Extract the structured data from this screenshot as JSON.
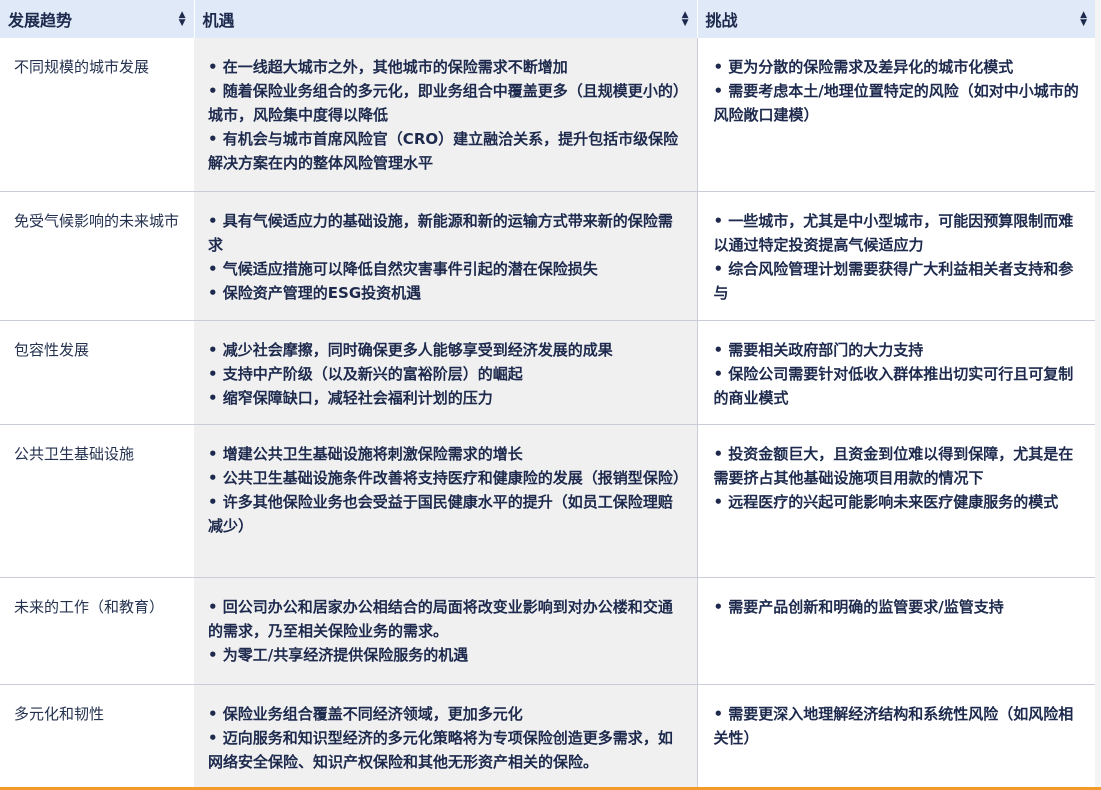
{
  "header": {
    "col1": "发展趋势",
    "col2": "机遇",
    "col3": "挑战",
    "sort_glyph_up": "▲",
    "sort_glyph_down": "▼"
  },
  "rows": [
    {
      "trend": "不同规模的城市发展",
      "opportunities": [
        "• 在一线超大城市之外，其他城市的保险需求不断增加",
        "• 随着保险业务组合的多元化，即业务组合中覆盖更多（且规模更小的）城市，风险集中度得以降低",
        "• 有机会与城市首席风险官（CRO）建立融洽关系，提升包括市级保险解决方案在内的整体风险管理水平"
      ],
      "challenges": [
        "• 更为分散的保险需求及差异化的城市化模式",
        "• 需要考虑本土/地理位置特定的风险（如对中小城市的风险敞口建模）"
      ]
    },
    {
      "trend": "免受气候影响的未来城市",
      "opportunities": [
        "• 具有气候适应力的基础设施，新能源和新的运输方式带来新的保险需求",
        "• 气候适应措施可以降低自然灾害事件引起的潜在保险损失",
        "• 保险资产管理的ESG投资机遇"
      ],
      "challenges": [
        "• 一些城市，尤其是中小型城市，可能因预算限制而难以通过特定投资提高气候适应力",
        "• 综合风险管理计划需要获得广大利益相关者支持和参与"
      ]
    },
    {
      "trend": "包容性发展",
      "opportunities": [
        "• 减少社会摩擦，同时确保更多人能够享受到经济发展的成果",
        "• 支持中产阶级（以及新兴的富裕阶层）的崛起",
        "• 缩窄保障缺口，减轻社会福利计划的压力"
      ],
      "challenges": [
        "• 需要相关政府部门的大力支持",
        "• 保险公司需要针对低收入群体推出切实可行且可复制的商业模式"
      ]
    },
    {
      "trend": "公共卫生基础设施",
      "opportunities": [
        "• 增建公共卫生基础设施将刺激保险需求的增长",
        "• 公共卫生基础设施条件改善将支持医疗和健康险的发展（报销型保险）",
        "• 许多其他保险业务也会受益于国民健康水平的提升（如员工保险理赔减少）"
      ],
      "challenges": [
        "• 投资金额巨大，且资金到位难以得到保障，尤其是在需要挤占其他基础设施项目用款的情况下",
        "• 远程医疗的兴起可能影响未来医疗健康服务的模式"
      ]
    },
    {
      "trend": "未来的工作（和教育）",
      "opportunities": [
        "• 回公司办公和居家办公相结合的局面将改变业影响到对办公楼和交通的需求，乃至相关保险业务的需求。",
        "• 为零工/共享经济提供保险服务的机遇"
      ],
      "challenges": [
        "• 需要产品创新和明确的监管要求/监管支持"
      ]
    },
    {
      "trend": "多元化和韧性",
      "opportunities": [
        "• 保险业务组合覆盖不同经济领域，更加多元化",
        "• 迈向服务和知识型经济的多元化策略将为专项保险创造更多需求，如网络安全保险、知识产权保险和其他无形资产相关的保险。"
      ],
      "challenges": [
        "• 需要更深入地理解经济结构和系统性风险（如风险相关性）"
      ]
    }
  ],
  "colors": {
    "header_bg": "#dfe9f7",
    "opportunity_bg": "#f0f0f0",
    "text": "#1d2a4d",
    "accent_bottom": "#f39a2b"
  }
}
